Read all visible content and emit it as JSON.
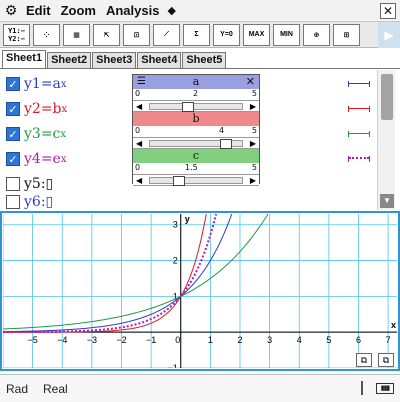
{
  "menubar": {
    "menus": [
      "Edit",
      "Zoom",
      "Analysis"
    ],
    "settings_icon": "gear-icon",
    "more_icon": "diamond-icon",
    "close_label": "✕"
  },
  "toolbar": {
    "buttons": [
      {
        "name": "y-switch-button",
        "label": "Y1:−\nY2:−"
      },
      {
        "name": "table-input-button",
        "label": "⁘"
      },
      {
        "name": "table-view-button",
        "label": "▦"
      },
      {
        "name": "view-window-button",
        "label": "⇱"
      },
      {
        "name": "zoom-box-button",
        "label": "⊡"
      },
      {
        "name": "trace-button",
        "label": "⟋"
      },
      {
        "name": "sketch-button",
        "label": "Σ"
      },
      {
        "name": "root-button",
        "label": "Y=0"
      },
      {
        "name": "max-button",
        "label": "MAX"
      },
      {
        "name": "min-button",
        "label": "MIN"
      },
      {
        "name": "zoom-auto-button",
        "label": "⊕"
      },
      {
        "name": "modify-button",
        "label": "⊞"
      }
    ]
  },
  "tabs": [
    "Sheet1",
    "Sheet2",
    "Sheet3",
    "Sheet4",
    "Sheet5"
  ],
  "active_tab": "Sheet1",
  "functions": [
    {
      "label": "y1=a",
      "exp": "x",
      "color": "#2b3fc2",
      "checked": true,
      "style": "solid"
    },
    {
      "label": "y2=b",
      "exp": "x",
      "color": "#e0191f",
      "checked": true,
      "style": "solid"
    },
    {
      "label": "y3=c",
      "exp": "x",
      "color": "#1e9a3c",
      "checked": true,
      "style": "solid"
    },
    {
      "label": "y4=e",
      "exp": "x",
      "color": "#b21ab8",
      "checked": true,
      "style": "dotted"
    },
    {
      "label": "y5:▯",
      "exp": "",
      "color": "#111111",
      "checked": false,
      "style": "none"
    },
    {
      "label": "y6:▯",
      "exp": "",
      "color": "#2b3fc2",
      "checked": false,
      "style": "none"
    }
  ],
  "sliders": [
    {
      "name": "a",
      "min": "0",
      "value_label": "2",
      "max": "5",
      "value": 2,
      "color": "#9a9fe0"
    },
    {
      "name": "b",
      "min": "0",
      "value_label": "4",
      "max": "5",
      "value": 4,
      "color": "#f08a8a"
    },
    {
      "name": "c",
      "min": "0",
      "value_label": "1.5",
      "max": "5",
      "value": 1.5,
      "color": "#7fd07f"
    }
  ],
  "chart_data": {
    "type": "line",
    "xlim": [
      -6,
      7.3
    ],
    "ylim": [
      -1,
      3.3
    ],
    "x_ticks": [
      "−5",
      "−4",
      "−3",
      "−2",
      "−1",
      "0",
      "1",
      "2",
      "3",
      "4",
      "5",
      "6",
      "7"
    ],
    "y_ticks": [
      "3",
      "2",
      "1",
      "−1"
    ],
    "xlabel": "x",
    "ylabel": "y",
    "grid": true,
    "series": [
      {
        "base": 2,
        "color": "#2b3fc2",
        "style": "solid"
      },
      {
        "base": 4,
        "color": "#e0191f",
        "style": "solid"
      },
      {
        "base": 1.5,
        "color": "#1e9a3c",
        "style": "solid"
      },
      {
        "base": 2.718,
        "color": "#b21ab8",
        "style": "dotted"
      }
    ]
  },
  "status": {
    "angle_mode": "Rad",
    "number_mode": "Real"
  }
}
